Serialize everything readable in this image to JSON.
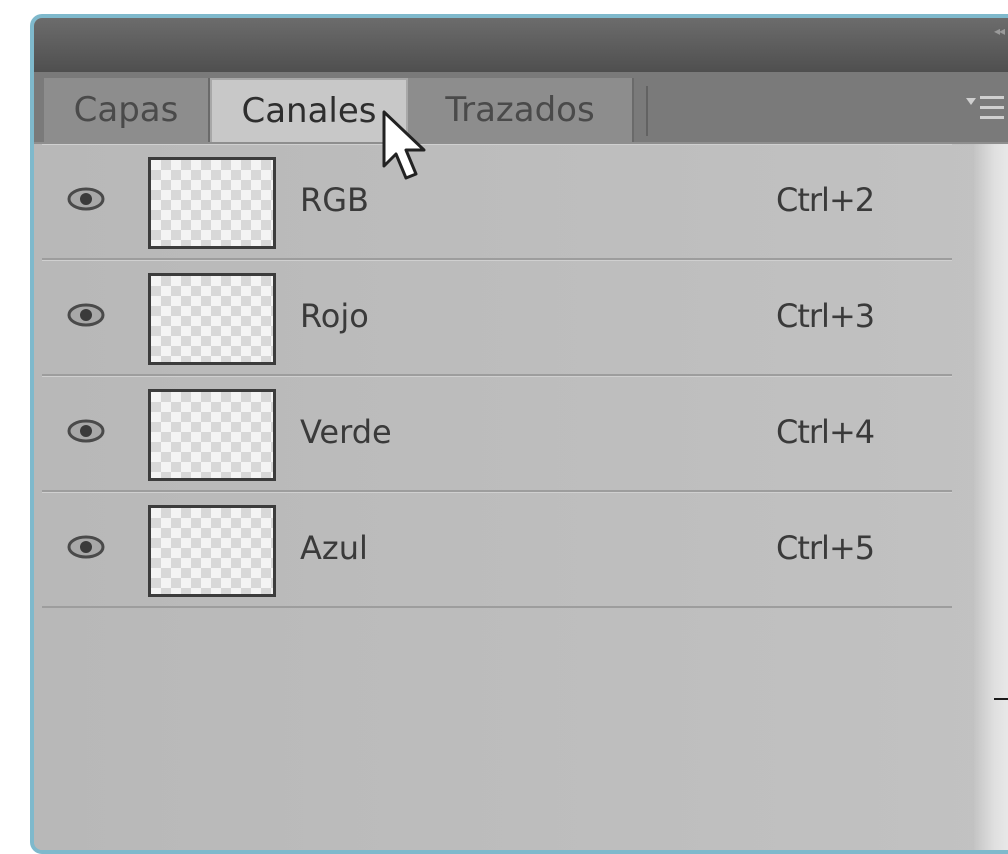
{
  "panel": {
    "tabs": [
      {
        "label": "Capas"
      },
      {
        "label": "Canales"
      },
      {
        "label": "Trazados"
      }
    ],
    "active_tab": "Canales",
    "channels": [
      {
        "name": "RGB",
        "shortcut": "Ctrl+2",
        "visible": true
      },
      {
        "name": "Rojo",
        "shortcut": "Ctrl+3",
        "visible": true
      },
      {
        "name": "Verde",
        "shortcut": "Ctrl+4",
        "visible": true
      },
      {
        "name": "Azul",
        "shortcut": "Ctrl+5",
        "visible": true
      }
    ]
  },
  "icons": {
    "visibility": "eye-icon",
    "panel_menu": "panel-menu-icon",
    "cursor": "mouse-pointer-icon",
    "collapse": "collapse-grip-icon"
  },
  "colors": {
    "frame_border": "#7fb9cc",
    "title_bar": "#5a5a5a",
    "tab_bar": "#7a7a7a",
    "active_tab": "#c8c8c8",
    "panel_bg": "#bcbcbc"
  }
}
